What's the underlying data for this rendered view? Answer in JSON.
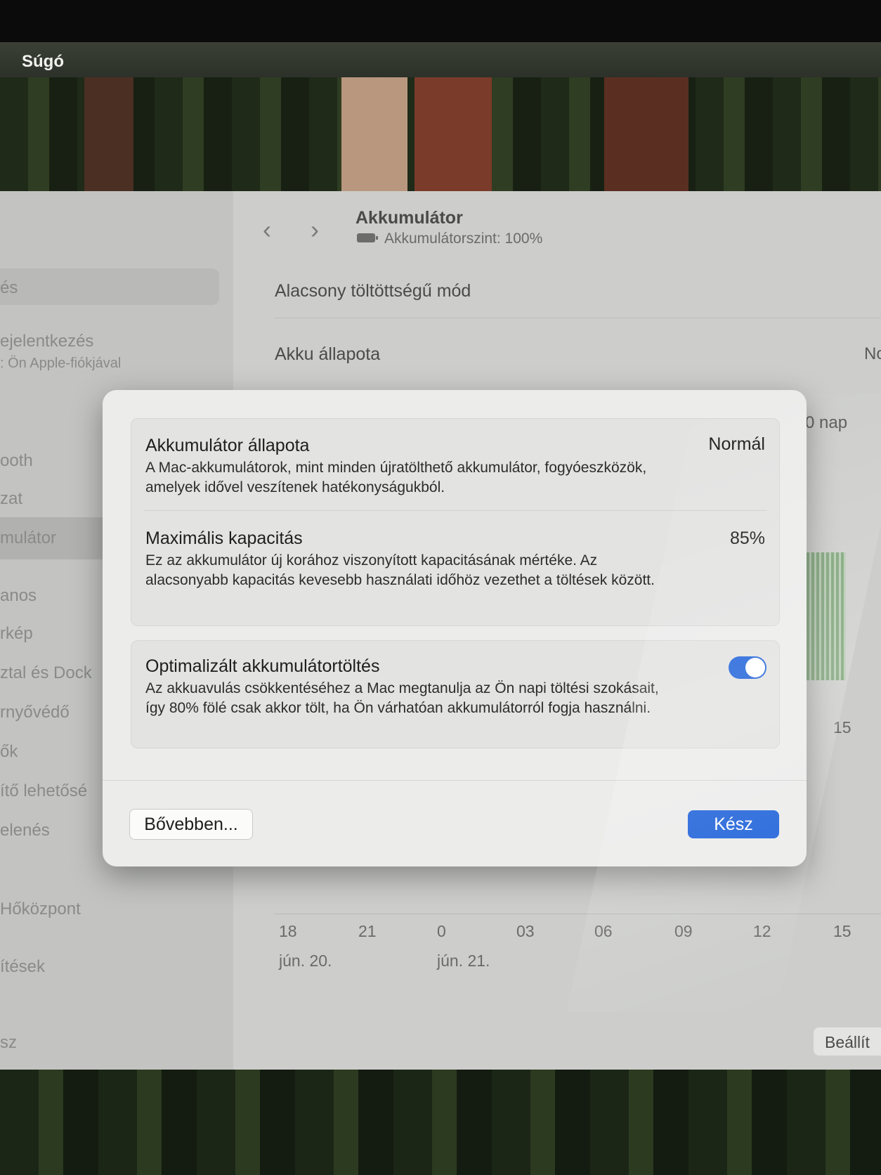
{
  "menubar": {
    "help": "Súgó"
  },
  "sidebar": {
    "items": [
      "és",
      "ejelentkezés",
      "ooth",
      "zat",
      "mulátor",
      "anos",
      "rkép",
      "ztal és Dock",
      "rnyővédő",
      "ők",
      "ítő lehetősé",
      "elenés",
      "Hőközpont",
      "ítések",
      "sz"
    ],
    "apple_sub": "Ön Apple-fiókjával"
  },
  "window": {
    "title": "Akkumulátor",
    "subtitle": "Akkumulátorszint: 100%",
    "rows": [
      "Alacsony töltöttségű mód",
      "Akku állapota"
    ],
    "right_fragments": {
      "state": "No",
      "days": "0 nap",
      "tick_mid": "15"
    },
    "chart_x_ticks": [
      "18",
      "21",
      "0",
      "03",
      "06",
      "09",
      "12",
      "15"
    ],
    "chart_dates": [
      "jún. 20.",
      "jún. 21."
    ],
    "settings_button": "Beállít"
  },
  "modal": {
    "health_title": "Akkumulátor állapota",
    "health_value": "Normál",
    "health_desc": "A Mac-akkumulátorok, mint minden újratölthető akkumulátor, fogyóeszközök, amelyek idővel veszítenek hatékonyságukból.",
    "capacity_title": "Maximális kapacitás",
    "capacity_value": "85%",
    "capacity_desc": "Ez az akkumulátor új korához viszonyított kapacitásának mértéke. Az alacsonyabb kapacitás kevesebb használati időhöz vezethet a töltések között.",
    "optimized_title": "Optimalizált akkumulátortöltés",
    "optimized_desc": "Az akkuavulás csökkentéséhez a Mac megtanulja az Ön napi töltési szokásait, így 80% fölé csak akkor tölt, ha Ön várhatóan akkumulátorról fogja használni.",
    "optimized_enabled": true,
    "more_button": "Bővebben...",
    "done_button": "Kész"
  },
  "colors": {
    "accent": "#1f62d9"
  }
}
